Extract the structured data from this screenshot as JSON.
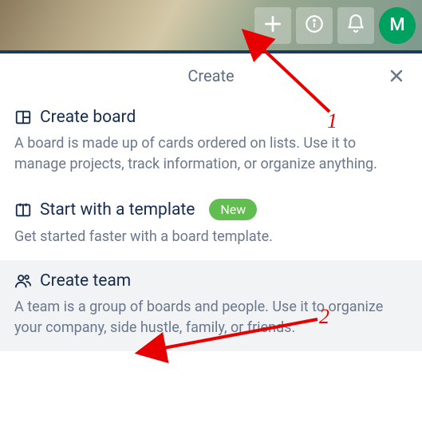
{
  "topbar": {
    "avatar_initial": "M"
  },
  "panel": {
    "title": "Create"
  },
  "options": {
    "create_board": {
      "title": "Create board",
      "desc": "A board is made up of cards ordered on lists. Use it to manage projects, track information, or organize anything."
    },
    "start_template": {
      "title": "Start with a template",
      "badge": "New",
      "desc": "Get started faster with a board template."
    },
    "create_team": {
      "title": "Create team",
      "desc": "A team is a group of boards and people. Use it to organize your company, side hustle, family, or friends."
    }
  },
  "annotations": {
    "step1": "1",
    "step2": "2"
  }
}
